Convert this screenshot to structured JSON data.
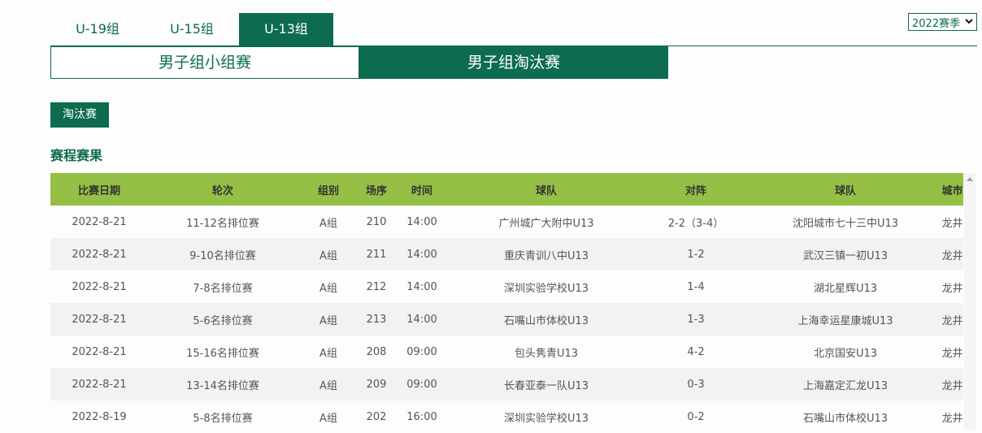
{
  "age_tabs": [
    {
      "label": "U-19组",
      "active": false
    },
    {
      "label": "U-15组",
      "active": false
    },
    {
      "label": "U-13组",
      "active": true
    }
  ],
  "season_select": {
    "selected": "2022赛季"
  },
  "stage_tabs": [
    {
      "label": "男子组小组赛",
      "active": false
    },
    {
      "label": "男子组淘汰赛",
      "active": true
    }
  ],
  "knockout_button": "淘汰赛",
  "section_title": "赛程赛果",
  "table": {
    "headers": [
      "比赛日期",
      "轮次",
      "组别",
      "场序",
      "时间",
      "球队",
      "对阵",
      "球队",
      "城市"
    ],
    "rows": [
      [
        "2022-8-21",
        "11-12名排位赛",
        "A组",
        "210",
        "14:00",
        "广州城广大附中U13",
        "2-2（3-4）",
        "沈阳城市七十三中U13",
        "龙井"
      ],
      [
        "2022-8-21",
        "9-10名排位赛",
        "A组",
        "211",
        "14:00",
        "重庆青训八中U13",
        "1-2",
        "武汉三镇一初U13",
        "龙井"
      ],
      [
        "2022-8-21",
        "7-8名排位赛",
        "A组",
        "212",
        "14:00",
        "深圳实验学校U13",
        "1-4",
        "湖北星辉U13",
        "龙井"
      ],
      [
        "2022-8-21",
        "5-6名排位赛",
        "A组",
        "213",
        "14:00",
        "石嘴山市体校U13",
        "1-3",
        "上海幸运星康城U13",
        "龙井"
      ],
      [
        "2022-8-21",
        "15-16名排位赛",
        "A组",
        "208",
        "09:00",
        "包头隽青U13",
        "4-2",
        "北京国安U13",
        "龙井"
      ],
      [
        "2022-8-21",
        "13-14名排位赛",
        "A组",
        "209",
        "09:00",
        "长春亚泰一队U13",
        "0-3",
        "上海嘉定汇龙U13",
        "龙井"
      ],
      [
        "2022-8-19",
        "5-8名排位赛",
        "A组",
        "202",
        "16:00",
        "深圳实验学校U13",
        "0-2",
        "石嘴山市体校U13",
        "龙井"
      ]
    ]
  },
  "colors": {
    "brand_green": "#0d6b4f",
    "header_green": "#95bf45"
  }
}
